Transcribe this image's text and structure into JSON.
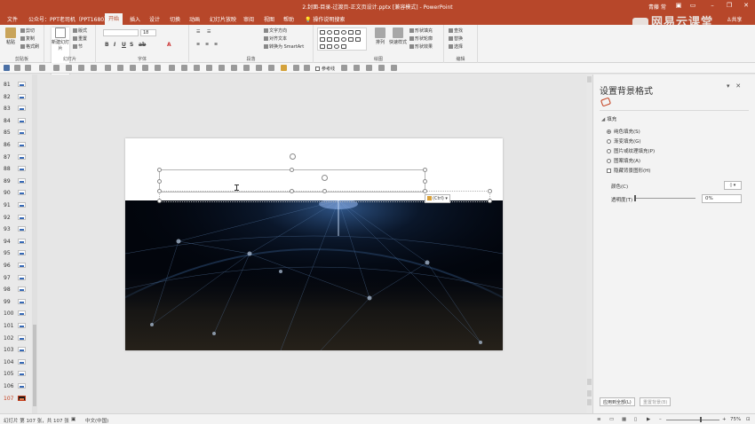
{
  "titlebar": {
    "doc_title": "2.封面-目录-过渡页-正文页设计.pptx [兼容模式] - PowerPoint",
    "user": "青藤 常"
  },
  "menu": {
    "file": "文件",
    "public": "公众号：PPT老司机（PPT1680）",
    "home": "开始",
    "insert": "插入",
    "design": "设计",
    "transitions": "切换",
    "animations": "动画",
    "slideshow": "幻灯片放映",
    "review": "审阅",
    "view": "视图",
    "help": "帮助",
    "tell_me": "操作说明搜索",
    "share": "共享"
  },
  "watermark": "网易云课堂",
  "ribbon": {
    "paste": "粘贴",
    "cut": "剪切",
    "copy": "复制",
    "format_painter": "格式刷",
    "clipboard": "剪贴板",
    "new_slide": "新建幻灯片",
    "layout": "版式",
    "reset": "重置",
    "section": "节",
    "slides": "幻灯片",
    "font_size": "18",
    "font": "字体",
    "text_direction": "文字方向",
    "align_text": "对齐文本",
    "smartart": "转换为 SmartArt",
    "paragraph": "段落",
    "arrange": "排列",
    "quick_styles": "快速样式",
    "shape_fill": "形状填充",
    "shape_outline": "形状轮廓",
    "shape_effects": "形状效果",
    "drawing": "绘图",
    "find": "查找",
    "replace": "替换",
    "select": "选择",
    "editing": "编辑"
  },
  "qat": {
    "reference_line": "参考线"
  },
  "thumbnails": [
    {
      "num": "81"
    },
    {
      "num": "82"
    },
    {
      "num": "83"
    },
    {
      "num": "84"
    },
    {
      "num": "85"
    },
    {
      "num": "86"
    },
    {
      "num": "87"
    },
    {
      "num": "88"
    },
    {
      "num": "89"
    },
    {
      "num": "90"
    },
    {
      "num": "91"
    },
    {
      "num": "92"
    },
    {
      "num": "93"
    },
    {
      "num": "94"
    },
    {
      "num": "95"
    },
    {
      "num": "96"
    },
    {
      "num": "97"
    },
    {
      "num": "98"
    },
    {
      "num": "99"
    },
    {
      "num": "100"
    },
    {
      "num": "101"
    },
    {
      "num": "102"
    },
    {
      "num": "103"
    },
    {
      "num": "104"
    },
    {
      "num": "105"
    },
    {
      "num": "106"
    },
    {
      "num": "107"
    }
  ],
  "selected_slide": "107",
  "paste_options_tag": "(Ctrl)",
  "format_pane": {
    "title": "设置背景格式",
    "section": "填充",
    "options": [
      "纯色填充(S)",
      "渐变填充(G)",
      "图片或纹理填充(P)",
      "图案填充(A)"
    ],
    "selected_option": "纯色填充(S)",
    "hide_graphics": "隐藏背景图形(H)",
    "color_label": "颜色(C)",
    "transparency_label": "透明度(T)",
    "transparency_value": "0%",
    "apply_all": "应用到全部(L)",
    "reset_background": "重置背景(B)"
  },
  "statusbar": {
    "slide_info": "幻灯片 第 107 张，共 107 张",
    "language": "中文(中国)",
    "zoom": "75%"
  },
  "colors": {
    "accent": "#b7472a",
    "selected": "#c43e1c"
  }
}
